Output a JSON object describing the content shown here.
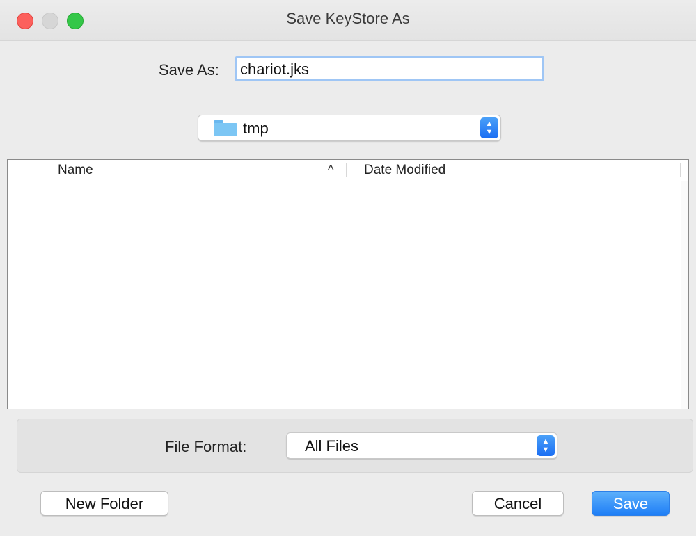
{
  "window": {
    "title": "Save KeyStore As"
  },
  "save_as": {
    "label": "Save As:",
    "value": "chariot.jks"
  },
  "location": {
    "label": "tmp",
    "icon": "folder-icon"
  },
  "file_list": {
    "columns": [
      "Name",
      "Date Modified"
    ],
    "sort_icon": "^",
    "rows": []
  },
  "file_format": {
    "label": "File Format:",
    "value": "All Files"
  },
  "buttons": {
    "new_folder": "New Folder",
    "cancel": "Cancel",
    "save": "Save"
  },
  "colors": {
    "accent": "#1e7ef6",
    "close": "#fc605c",
    "zoom": "#34c748",
    "folder": "#7cc6f4"
  }
}
